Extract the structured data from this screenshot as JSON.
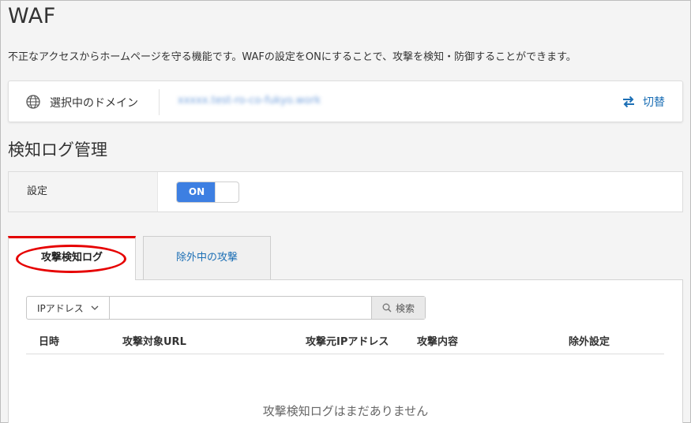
{
  "page": {
    "title": "WAF",
    "description": "不正なアクセスからホームページを守る機能です。WAFの設定をONにすることで、攻撃を検知・防御することができます。"
  },
  "domain": {
    "label": "選択中のドメイン",
    "value": "xxxxx.test-ro-co-fukyo.work",
    "switch_label": "切替",
    "globe_icon": "globe-icon",
    "switch_icon": "swap-arrows-icon"
  },
  "detection": {
    "section_title": "検知ログ管理",
    "setting_label": "設定",
    "toggle_label": "ON",
    "toggle_state": "on"
  },
  "tabs": [
    {
      "label": "攻撃検知ログ",
      "active": true
    },
    {
      "label": "除外中の攻撃",
      "active": false
    }
  ],
  "filter": {
    "selected_option": "IPアドレス",
    "input_value": "",
    "search_label": "検索"
  },
  "table": {
    "columns": [
      "日時",
      "攻撃対象URL",
      "攻撃元IPアドレス",
      "攻撃内容",
      "除外設定"
    ],
    "rows": [],
    "empty_message": "攻撃検知ログはまだありません"
  },
  "colors": {
    "accent_blue": "#1c6fb5",
    "toggle_blue": "#3d7fe2",
    "active_tab_border": "#e30000",
    "highlight_circle": "#e60000"
  }
}
